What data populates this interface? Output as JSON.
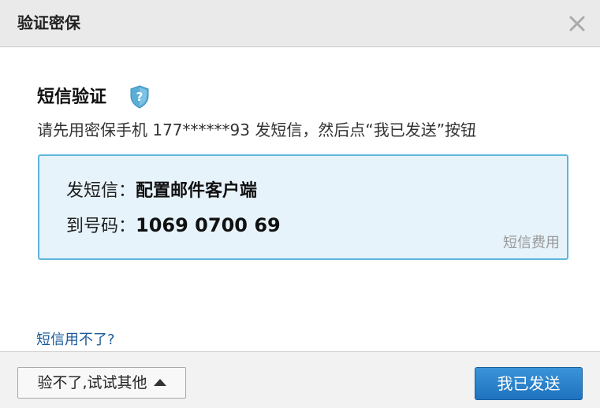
{
  "dialog": {
    "title": "验证密保",
    "close_icon": "close-icon"
  },
  "sms": {
    "heading": "短信验证",
    "help_icon": "shield-question-icon",
    "instruction": "请先用密保手机 177******93 发短信，然后点“我已发送”按钮",
    "send_label": "发短信：",
    "send_content": "配置邮件客户端",
    "number_label": "到号码：",
    "number": "1069 0700 69",
    "fee_link": "短信费用"
  },
  "help": {
    "cant_use_link": "短信用不了?"
  },
  "footer": {
    "other_methods_label": "验不了,试试其他",
    "other_methods_icon": "caret-up-icon",
    "sent_button_label": "我已发送"
  },
  "colors": {
    "info_box_bg": "#e6f3fa",
    "info_box_border": "#5eb6dd",
    "link": "#1a5a9a",
    "primary_button": "#2a84cc"
  }
}
